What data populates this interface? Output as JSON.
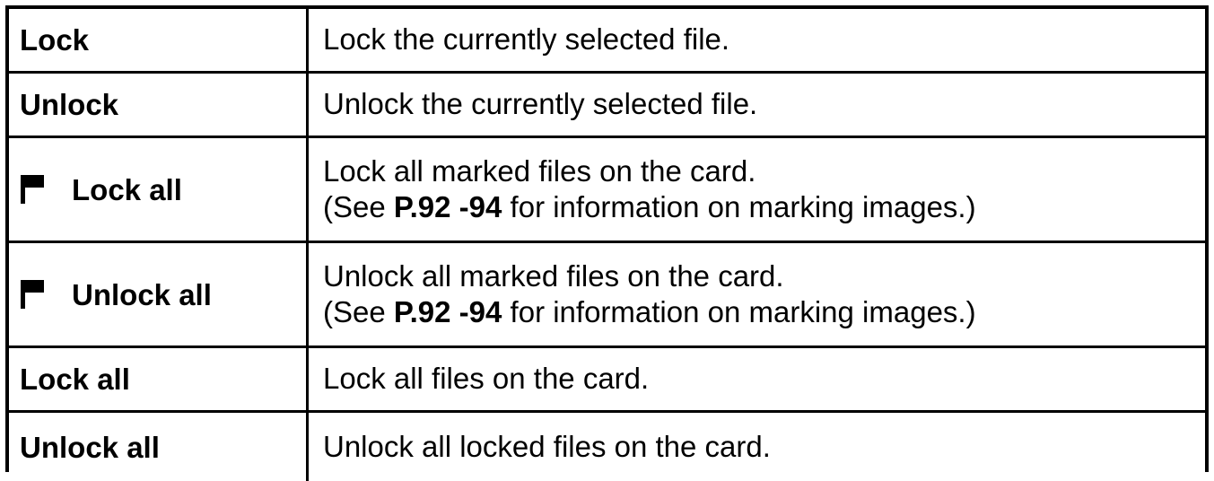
{
  "rows": [
    {
      "label": "Lock",
      "desc_line1": "Lock the currently selected file."
    },
    {
      "label": "Unlock",
      "desc_line1": "Unlock the currently selected file."
    },
    {
      "label": "Lock all",
      "icon": "flag-icon",
      "desc_line1": "Lock all marked files on the card.",
      "desc_line2_prefix": "(See ",
      "desc_line2_ref": "P.92 -94",
      "desc_line2_suffix": " for information on marking images.)"
    },
    {
      "label": "Unlock all",
      "icon": "flag-icon",
      "desc_line1": "Unlock all marked files on the card.",
      "desc_line2_prefix": "(See ",
      "desc_line2_ref": "P.92 -94",
      "desc_line2_suffix": " for information on marking images.)"
    },
    {
      "label": "Lock all",
      "desc_line1": "Lock all files on the card."
    },
    {
      "label": "Unlock all",
      "desc_line1": "Unlock all locked files on the card."
    }
  ],
  "colors": {
    "text": "#000000",
    "border": "#000000",
    "background": "#ffffff"
  }
}
